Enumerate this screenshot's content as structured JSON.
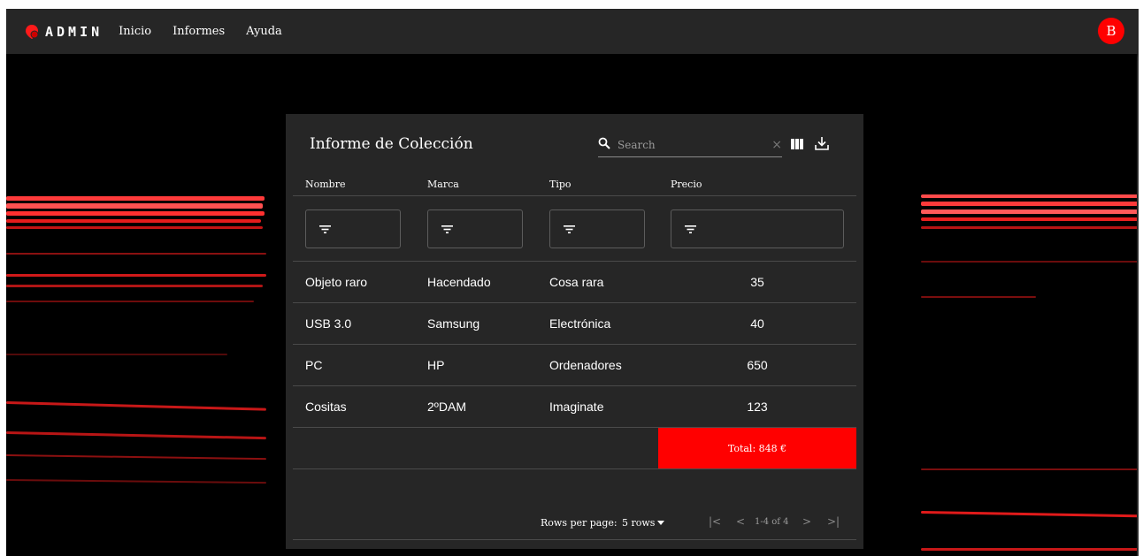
{
  "app": {
    "brand": "ADMIN",
    "nav": [
      "Inicio",
      "Informes",
      "Ayuda"
    ],
    "avatar_initial": "B",
    "accent_color": "#ff0000"
  },
  "report": {
    "title": "Informe de Colección",
    "search_placeholder": "Search",
    "icons": [
      "search-icon",
      "clear-icon",
      "columns-icon",
      "download-icon",
      "filter-icon"
    ],
    "columns": [
      "Nombre",
      "Marca",
      "Tipo",
      "Precio"
    ],
    "rows": [
      [
        "Objeto raro",
        "Hacendado",
        "Cosa rara",
        "35"
      ],
      [
        "USB 3.0",
        "Samsung",
        "Electrónica",
        "40"
      ],
      [
        "PC",
        "HP",
        "Ordenadores",
        "650"
      ],
      [
        "Cositas",
        "2ºDAM",
        "Imaginate",
        "123"
      ]
    ],
    "total": "Total: 848 €"
  },
  "pagination": {
    "rows_per_page_label": "Rows per page:",
    "rows_per_page_value": "5 rows",
    "range": "1-4 of 4",
    "first_glyph": "|<",
    "prev_glyph": "<",
    "next_glyph": ">",
    "last_glyph": ">|"
  }
}
